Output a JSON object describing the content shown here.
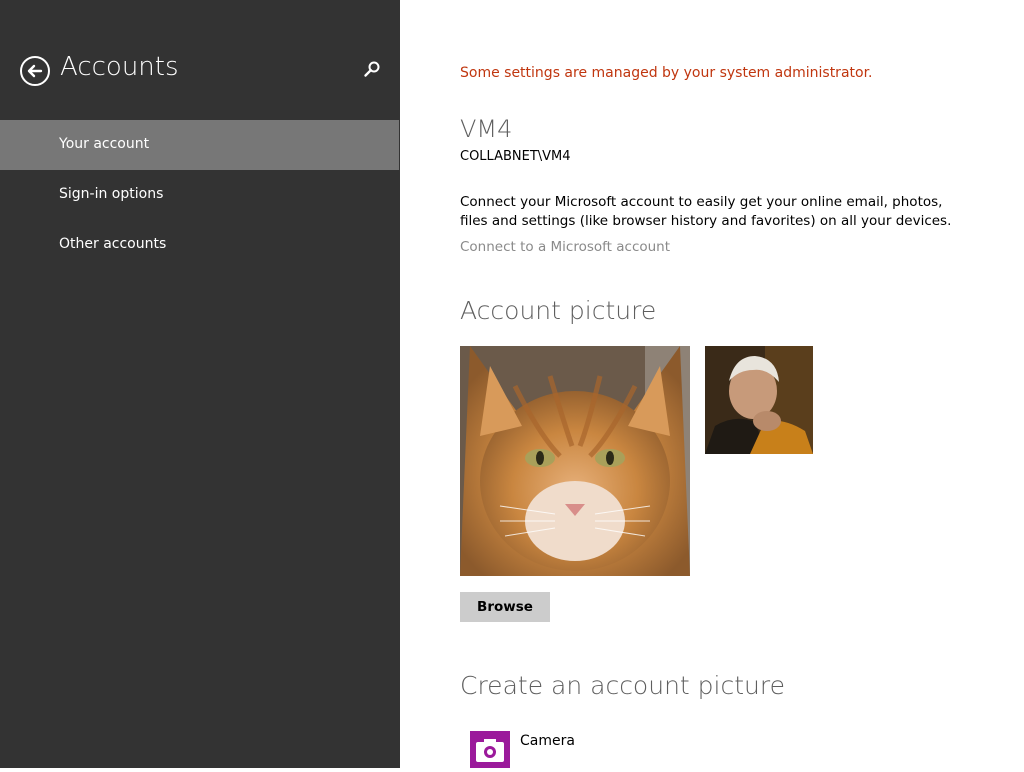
{
  "sidebar": {
    "title": "Accounts",
    "back_icon": "back-arrow-icon",
    "search_icon": "search-icon",
    "items": [
      {
        "label": "Your account",
        "selected": true
      },
      {
        "label": "Sign-in options",
        "selected": false
      },
      {
        "label": "Other accounts",
        "selected": false
      }
    ]
  },
  "main": {
    "admin_notice": "Some settings are managed by your system administrator.",
    "user_name": "VM4",
    "user_domain": "COLLABNET\\VM4",
    "description": "Connect your Microsoft account to easily get your online email, photos, files and settings (like browser history and favorites) on all your devices.",
    "connect_link": "Connect to a Microsoft account",
    "account_picture_heading": "Account picture",
    "browse_label": "Browse",
    "create_heading": "Create an account picture",
    "create_items": [
      {
        "label": "Camera",
        "icon": "camera-icon"
      }
    ]
  },
  "colors": {
    "sidebar_bg": "#333333",
    "sidebar_selected": "#777777",
    "admin_notice": "#c0360f",
    "camera_tile": "#9b1a9b"
  }
}
